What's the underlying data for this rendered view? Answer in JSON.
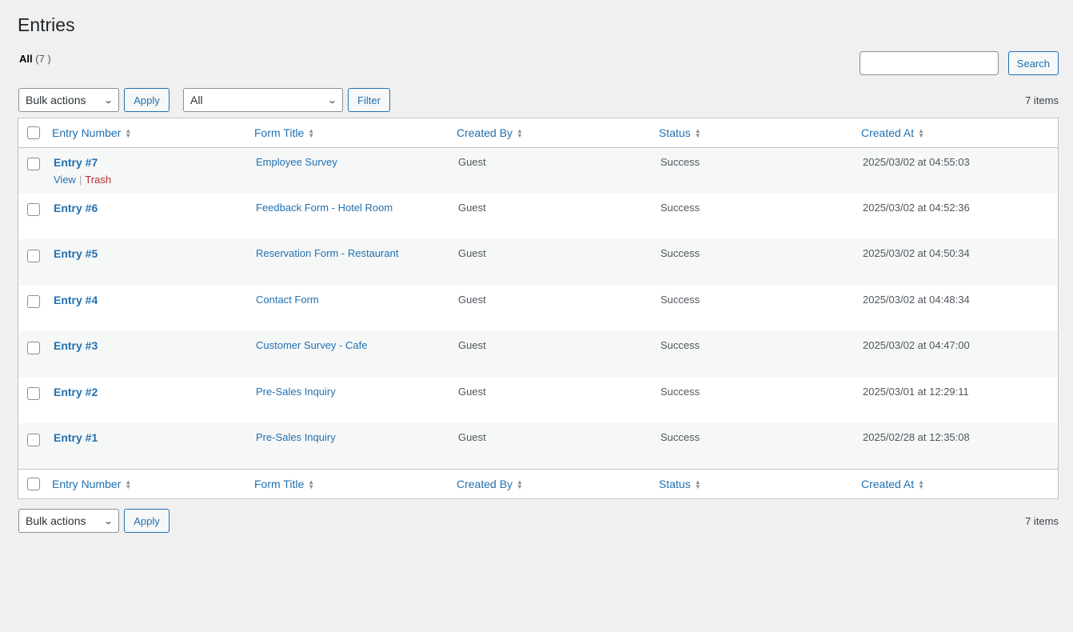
{
  "page": {
    "title": "Entries"
  },
  "views": {
    "all_label": "All",
    "all_count": "(7 )"
  },
  "search": {
    "placeholder": "",
    "button_label": "Search"
  },
  "top_nav": {
    "bulk_actions": "Bulk actions",
    "apply": "Apply",
    "form_filter": "All",
    "filter": "Filter",
    "items_count": "7 items"
  },
  "bottom_nav": {
    "bulk_actions": "Bulk actions",
    "apply": "Apply",
    "items_count": "7 items"
  },
  "columns": [
    "Entry Number",
    "Form Title",
    "Created By",
    "Status",
    "Created At"
  ],
  "rows": [
    {
      "entry": "Entry #7",
      "form": "Employee Survey",
      "created_by": "Guest",
      "status": "Success",
      "created_at": "2025/03/02 at 04:55:03"
    },
    {
      "entry": "Entry #6",
      "form": "Feedback Form - Hotel Room",
      "created_by": "Guest",
      "status": "Success",
      "created_at": "2025/03/02 at 04:52:36"
    },
    {
      "entry": "Entry #5",
      "form": "Reservation Form - Restaurant",
      "created_by": "Guest",
      "status": "Success",
      "created_at": "2025/03/02 at 04:50:34"
    },
    {
      "entry": "Entry #4",
      "form": "Contact Form",
      "created_by": "Guest",
      "status": "Success",
      "created_at": "2025/03/02 at 04:48:34"
    },
    {
      "entry": "Entry #3",
      "form": "Customer Survey - Cafe",
      "created_by": "Guest",
      "status": "Success",
      "created_at": "2025/03/02 at 04:47:00"
    },
    {
      "entry": "Entry #2",
      "form": "Pre-Sales Inquiry",
      "created_by": "Guest",
      "status": "Success",
      "created_at": "2025/03/01 at 12:29:11"
    },
    {
      "entry": "Entry #1",
      "form": "Pre-Sales Inquiry",
      "created_by": "Guest",
      "status": "Success",
      "created_at": "2025/02/28 at 12:35:08"
    }
  ],
  "row_actions": {
    "view": "View",
    "separator": "|",
    "trash": "Trash"
  },
  "colors": {
    "link": "#2271b1",
    "trash": "#b32d2e",
    "background": "#f0f0f1"
  },
  "icons": {
    "sort": "sort-icon",
    "dropdown": "chevron-down-icon"
  }
}
